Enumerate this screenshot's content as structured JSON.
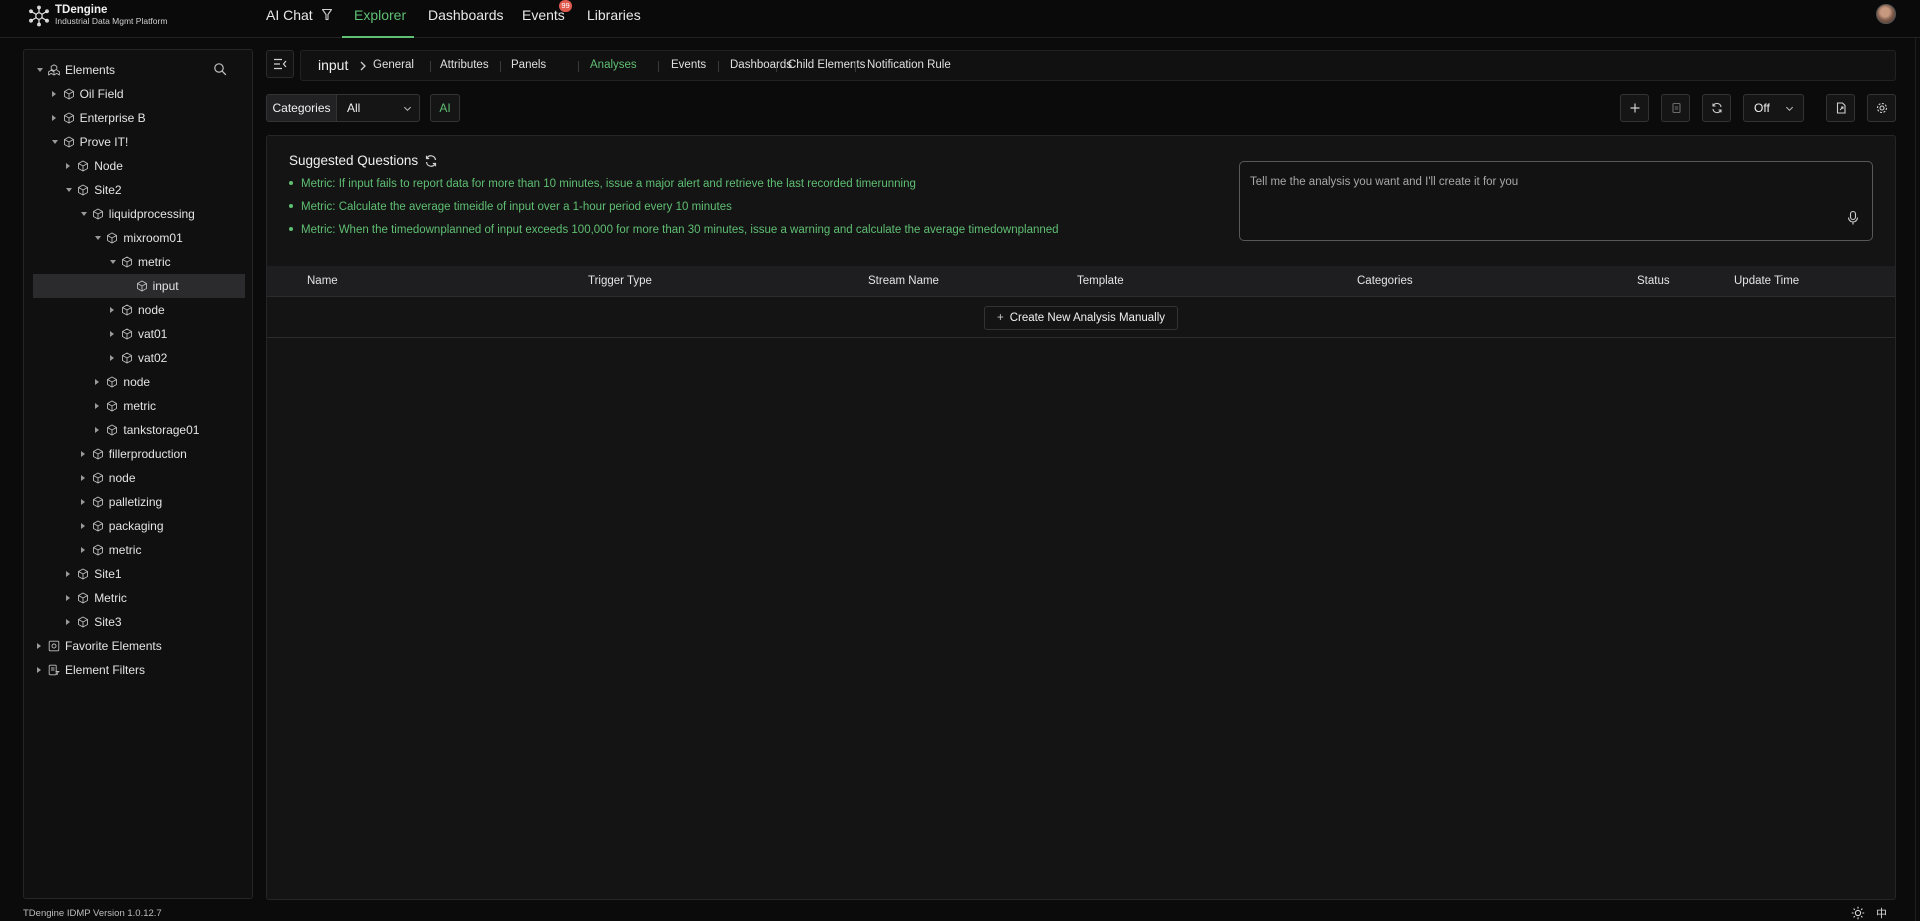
{
  "brand": {
    "name": "TDengine",
    "subtitle": "Industrial Data Mgmt Platform"
  },
  "nav": {
    "ai_chat": "AI Chat",
    "explorer": "Explorer",
    "dashboards": "Dashboards",
    "events": "Events",
    "events_badge": "99",
    "libraries": "Libraries",
    "active": "Explorer"
  },
  "tree": {
    "root": "Elements",
    "items": [
      "Oil Field",
      "Enterprise B",
      "Prove IT!",
      "Node",
      "Site2",
      "liquidprocessing",
      "mixroom01",
      "metric",
      "input",
      "node",
      "vat01",
      "vat02",
      "node",
      "metric",
      "tankstorage01",
      "fillerproduction",
      "node",
      "palletizing",
      "packaging",
      "metric",
      "Site1",
      "Metric",
      "Site3"
    ],
    "favorites": "Favorite Elements",
    "filters": "Element Filters",
    "selected": "input"
  },
  "breadcrumb": {
    "current": "input",
    "tabs": [
      "General",
      "Attributes",
      "Panels",
      "Analyses",
      "Events",
      "Dashboards",
      "Child Elements",
      "Notification Rule"
    ],
    "active_tab": "Analyses"
  },
  "toolbar": {
    "categories_label": "Categories",
    "categories_value": "All",
    "ai_label": "AI",
    "refresh_value": "Off"
  },
  "suggested": {
    "title": "Suggested Questions",
    "items": [
      "Metric: If input fails to report data for more than 10 minutes, issue a major alert and retrieve the last recorded timerunning",
      "Metric: Calculate the average timeidle of input over a 1-hour period every 10 minutes",
      "Metric: When the timedownplanned of input exceeds 100,000 for more than 30 minutes, issue a warning and calculate the average timedownplanned"
    ],
    "ask_placeholder": "Tell me the analysis you want and I'll create it for you"
  },
  "table": {
    "columns": [
      "Name",
      "Trigger Type",
      "Stream Name",
      "Template",
      "Categories",
      "Status",
      "Update Time"
    ],
    "create_label": "Create New Analysis Manually"
  },
  "footer": {
    "version": "TDengine IDMP Version 1.0.12.7",
    "lang": "中"
  },
  "colors": {
    "accent": "#5fbf72",
    "background": "#0b0b0c",
    "panel": "#141415",
    "badge": "#e05a4e"
  }
}
